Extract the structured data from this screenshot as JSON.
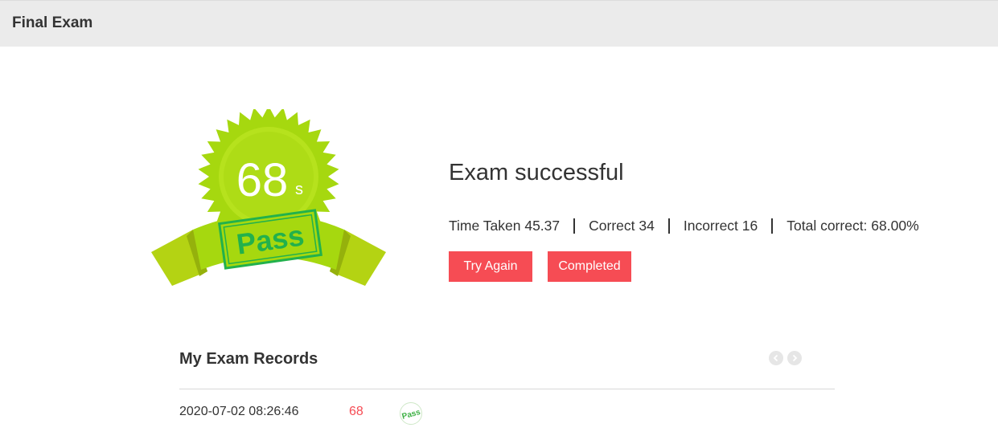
{
  "header": {
    "title": "Final Exam"
  },
  "badge": {
    "score": "68",
    "unit": "s",
    "stamp": "Pass"
  },
  "result": {
    "title": "Exam successful",
    "time_taken": "Time Taken 45.37",
    "correct": "Correct 34",
    "incorrect": "Incorrect 16",
    "total_correct": "Total correct: 68.00%"
  },
  "actions": {
    "retry": "Try Again",
    "completed": "Completed"
  },
  "records": {
    "title": "My Exam Records",
    "rows": [
      {
        "date": "2020-07-02 08:26:46",
        "score": "68",
        "status": "Pass"
      }
    ]
  },
  "colors": {
    "accent": "#f64c54",
    "badge_green": "#a6d80f",
    "stamp_green": "#22b14c"
  },
  "icons": {
    "prev": "chevron-left-icon",
    "next": "chevron-right-icon"
  }
}
